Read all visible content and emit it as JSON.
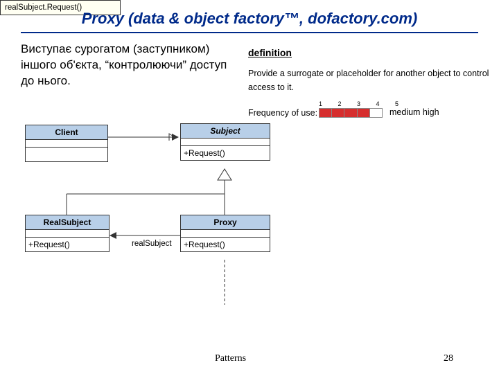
{
  "title": "Proxy (data & object factory™, dofactory.com)",
  "description": "  Виступає сурогатом (заступником) іншого об'єкта, “контролюючи” доступ до нього.",
  "definition": {
    "heading": "definition",
    "body": "Provide a surrogate or placeholder for another object to control access to it.",
    "freq_label": "Frequency of use:",
    "freq_scale": "1 2 3 4 5",
    "freq_value": 4,
    "freq_text": "medium high"
  },
  "uml": {
    "client": {
      "name": "Client"
    },
    "subject": {
      "name": "Subject",
      "op": "+Request()"
    },
    "real": {
      "name": "RealSubject",
      "op": "+Request()"
    },
    "proxy": {
      "name": "Proxy",
      "op": "+Request()"
    },
    "role": "realSubject",
    "note": "realSubject.Request()"
  },
  "footer": {
    "center": "Patterns",
    "page": "28"
  }
}
